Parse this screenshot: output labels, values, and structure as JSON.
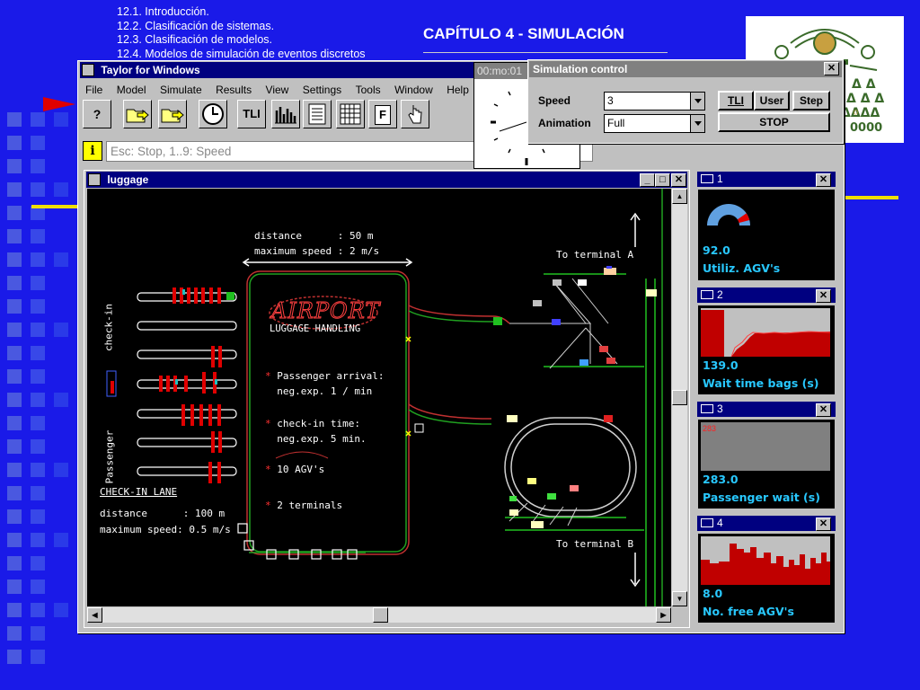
{
  "slide": {
    "toc": [
      "12.1. Introducción.",
      "12.2. Clasificación de sistemas.",
      "12.3. Clasificación de modelos.",
      "12.4. Modelos de simulación de eventos discretos"
    ],
    "chapter_title": "CAPÍTULO 4 - SIMULACIÓN"
  },
  "main_window": {
    "title": "Taylor for Windows",
    "menu": [
      "File",
      "Model",
      "Simulate",
      "Results",
      "View",
      "Settings",
      "Tools",
      "Window",
      "Help"
    ],
    "toolbar": {
      "help_label": "?",
      "tli_label": "TLI",
      "f_label": "F"
    },
    "status_text": "Esc: Stop, 1..9: Speed"
  },
  "clock": {
    "label": "00:mo:01"
  },
  "sim_control": {
    "title": "Simulation control",
    "speed_label": "Speed",
    "speed_value": "3",
    "animation_label": "Animation",
    "animation_value": "Full",
    "tli_button": "TLI",
    "user_button": "User",
    "step_button": "Step",
    "stop_button": "STOP"
  },
  "luggage_window": {
    "title": "luggage",
    "distance_top": "distance      : 50 m",
    "speed_top": "maximum speed : 2 m/s",
    "to_terminal_a": "To terminal A",
    "to_terminal_b": "To terminal B",
    "airport_logo": "AIRPORT",
    "luggage_handling": "LUGGAGE HANDLING",
    "bullets": [
      {
        "line1": "Passenger arrival:",
        "line2": "neg.exp. 1 / min"
      },
      {
        "line1": "check-in time:",
        "line2": "neg.exp. 5 min."
      },
      {
        "line1": "10 AGV's",
        "line2": ""
      },
      {
        "line1": "2 terminals",
        "line2": ""
      }
    ],
    "check_in_vertical": "check-in",
    "passenger_vertical": "Passenger",
    "check_in_lane": "CHECK-IN LANE",
    "distance_bottom": "distance      : 100 m",
    "speed_bottom": "maximum speed: 0.5 m/s"
  },
  "panels": [
    {
      "num": "1",
      "value": "92.0",
      "label": "Utiliz. AGV's",
      "level": 0.92
    },
    {
      "num": "2",
      "value": "139.0",
      "label": "Wait time bags (s)"
    },
    {
      "num": "3",
      "value": "283.0",
      "label": "Passenger wait (s)",
      "inner": "283"
    },
    {
      "num": "4",
      "value": "8.0",
      "label": "No. free AGV's"
    }
  ],
  "colors": {
    "slide_bg": "#1a1ae8",
    "title_bar": "#000080",
    "panel_value": "#28c8ff",
    "graph_red": "#c00000"
  }
}
